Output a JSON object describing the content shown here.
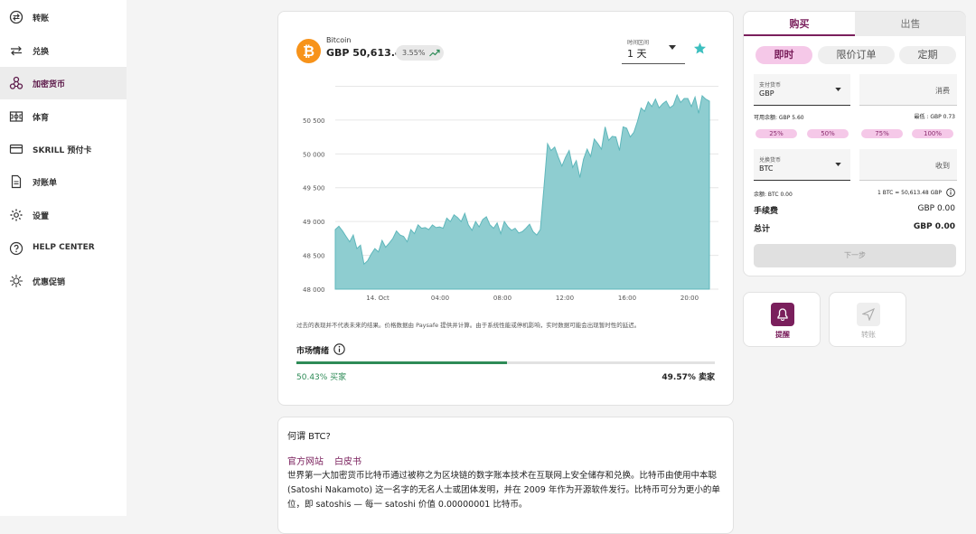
{
  "sidebar": {
    "items": [
      {
        "label": "转账",
        "icon": "transfer-icon"
      },
      {
        "label": "兑换",
        "icon": "exchange-icon"
      },
      {
        "label": "加密货币",
        "icon": "crypto-icon",
        "active": true
      },
      {
        "label": "体育",
        "icon": "sports-icon"
      },
      {
        "label": "SKRILL 预付卡",
        "icon": "card-icon"
      },
      {
        "label": "对账单",
        "icon": "statement-icon"
      },
      {
        "label": "设置",
        "icon": "gear-icon"
      },
      {
        "label": "HELP CENTER",
        "icon": "help-icon"
      },
      {
        "label": "优惠促销",
        "icon": "promo-icon"
      }
    ]
  },
  "coin": {
    "name": "Bitcoin",
    "price": "GBP 50,613.48",
    "change": "3.55%",
    "symbol_glyph": "₿",
    "range_label": "时间区间",
    "range_value": "1 天"
  },
  "chart_data": {
    "type": "area",
    "x_ticks": [
      "14. Oct",
      "04:00",
      "08:00",
      "12:00",
      "16:00",
      "20:00"
    ],
    "y_ticks": [
      48000,
      48500,
      49000,
      49500,
      50000,
      50500
    ],
    "ylim": [
      48000,
      51100
    ],
    "values": [
      48880,
      48930,
      48860,
      48780,
      48700,
      48800,
      48600,
      48650,
      48370,
      48420,
      48520,
      48600,
      48550,
      48720,
      48620,
      48680,
      48750,
      48860,
      48800,
      48780,
      48700,
      48880,
      48820,
      48950,
      48900,
      48910,
      48880,
      48950,
      48910,
      48920,
      48900,
      49050,
      49000,
      49100,
      49060,
      49000,
      49120,
      48950,
      48870,
      49000,
      48920,
      49030,
      49070,
      48950,
      48900,
      48980,
      48820,
      49000,
      48920,
      48870,
      48900,
      48830,
      48850,
      48900,
      48960,
      48850,
      48800,
      48880,
      49500,
      50150,
      50050,
      50100,
      49950,
      49820,
      49950,
      50050,
      49800,
      49900,
      49650,
      49920,
      50070,
      49960,
      50220,
      50150,
      50070,
      50400,
      50200,
      50260,
      50250,
      50050,
      50400,
      50380,
      50250,
      50320,
      50480,
      50680,
      50630,
      50770,
      50700,
      50810,
      50680,
      50740,
      50780,
      50680,
      50720,
      50870,
      50760,
      50820,
      50820,
      50700,
      50840,
      50600,
      50860,
      50810,
      50780
    ]
  },
  "disclaimer": "过去的表现并不代表未来的结果。价格数据由 Paysafe 提供并计算。由于系统性能或停机影响，实时数据可能会出现暂时性的延迟。",
  "sentiment": {
    "title": "市场情绪",
    "buy_fraction": 0.5043,
    "buy_label": "50.43% 买家",
    "sell_label": "49.57% 卖家"
  },
  "about": {
    "title": "何谓 BTC?",
    "link_website": "官方网站",
    "link_whitepaper": "白皮书",
    "body": "世界第一大加密货币比特币通过被称之为区块链的数字账本技术在互联网上安全储存和兑换。比特币由使用中本聪 (Satoshi Nakamoto) 这一名字的无名人士或团体发明，并在 2009 年作为开源软件发行。比特币可分为更小的单位，即 satoshis — 每一 satoshi 价值 0.00000001 比特币。"
  },
  "trade": {
    "tab_buy": "购买",
    "tab_sell": "出售",
    "mode_instant": "即时",
    "mode_limit": "限价订单",
    "mode_recurring": "定期",
    "pay_label": "支付货币",
    "pay_currency": "GBP",
    "spend_placeholder": "消费",
    "available": "可用余额: GBP 5.60",
    "minimum": "最低 : GBP 0.73",
    "percents": [
      "25%",
      "50%",
      "75%",
      "100%"
    ],
    "receive_label": "兑换货币",
    "receive_currency": "BTC",
    "receive_placeholder": "收到",
    "balance": "余额: BTC 0.00",
    "rate": "1 BTC = 50,613.48 GBP",
    "fee_label": "手续费",
    "fee_value": "GBP 0.00",
    "total_label": "总计",
    "total_value": "GBP 0.00",
    "next": "下一步"
  },
  "actions": {
    "alert": "提醒",
    "transfer": "转账"
  },
  "colors": {
    "accent": "#7a1f5c",
    "chart_fill": "#8ecdd0",
    "chart_line": "#5fb7bb",
    "buy_green": "#2e8b57",
    "star": "#3dbfbf"
  }
}
